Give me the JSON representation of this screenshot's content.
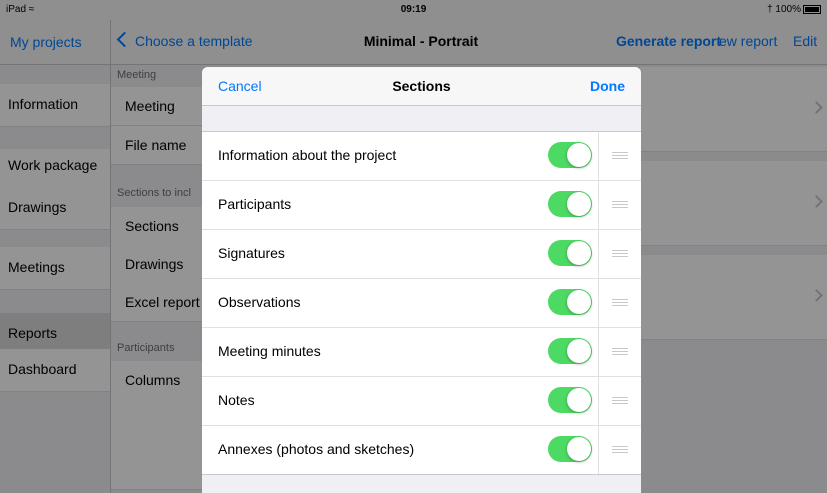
{
  "status_bar": {
    "device": "iPad",
    "wifi_icon": "wifi-icon",
    "time": "09:19",
    "bluetooth_icon": "bluetooth-icon",
    "battery": "100%"
  },
  "nav": {
    "left_link": "My projects",
    "back_label": "Choose a template",
    "title": "Minimal - Portrait",
    "generate_label": "Generate report",
    "new_report_label": "ew report",
    "edit_label": "Edit"
  },
  "sidebar": {
    "items": [
      {
        "label": "Information"
      },
      {
        "label": "Work package"
      },
      {
        "label": "Drawings"
      },
      {
        "label": "Meetings"
      },
      {
        "label": "Reports"
      },
      {
        "label": "Dashboard"
      }
    ]
  },
  "middle": {
    "headers": [
      "Meeting",
      "Sections to incl",
      "Participants"
    ],
    "rows": [
      {
        "label": "Meeting"
      },
      {
        "label": "File name"
      },
      {
        "label": "Sections"
      },
      {
        "label": "Drawings"
      },
      {
        "label": "Excel report"
      },
      {
        "label": "Columns"
      }
    ]
  },
  "modal": {
    "cancel_label": "Cancel",
    "title": "Sections",
    "done_label": "Done",
    "sections": [
      {
        "label": "Information about the project",
        "enabled": true
      },
      {
        "label": "Participants",
        "enabled": true
      },
      {
        "label": "Signatures",
        "enabled": true
      },
      {
        "label": "Observations",
        "enabled": true
      },
      {
        "label": "Meeting minutes",
        "enabled": true
      },
      {
        "label": "Notes",
        "enabled": true
      },
      {
        "label": "Annexes (photos and sketches)",
        "enabled": true
      }
    ]
  },
  "colors": {
    "accent": "#007aff",
    "toggle_on": "#4cd964"
  }
}
